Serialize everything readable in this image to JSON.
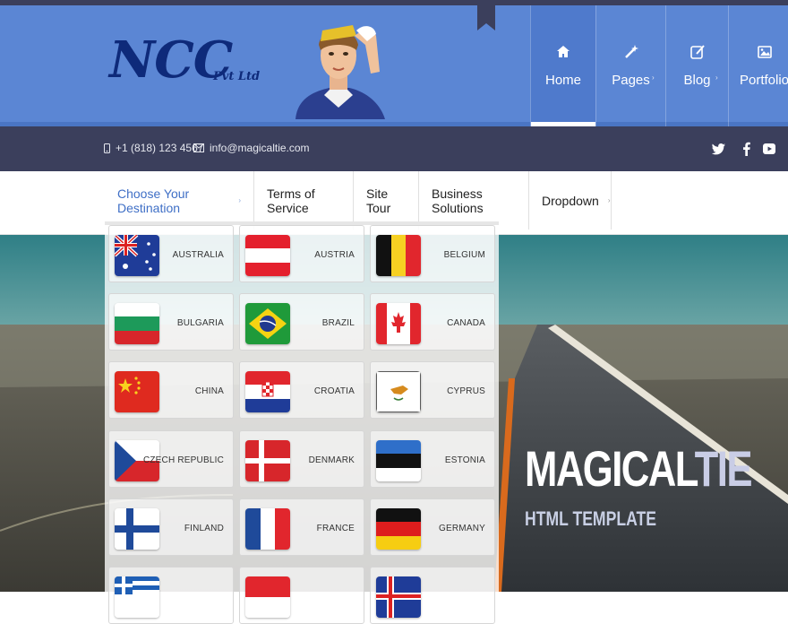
{
  "header": {
    "logo_main": "NCC",
    "logo_sub": "Pvt Ltd",
    "brand_color": "#5b86d4",
    "nav": [
      {
        "label": "Home",
        "icon": "home-icon",
        "active": true
      },
      {
        "label": "Pages",
        "icon": "magic-wand-icon",
        "active": false
      },
      {
        "label": "Blog",
        "icon": "edit-icon",
        "active": false
      },
      {
        "label": "Portfolio",
        "icon": "picture-icon",
        "active": false
      }
    ]
  },
  "infobar": {
    "phone": "+1 (818) 123 4567",
    "email": "info@magicaltie.com",
    "social": [
      "twitter-icon",
      "facebook-icon",
      "youtube-icon"
    ]
  },
  "menu": {
    "items": [
      "Choose Your Destination",
      "Terms of Service",
      "Site Tour",
      "Business Solutions",
      "Dropdown"
    ]
  },
  "destinations": [
    {
      "name": "AUSTRALIA"
    },
    {
      "name": "AUSTRIA"
    },
    {
      "name": "BELGIUM"
    },
    {
      "name": "BULGARIA"
    },
    {
      "name": "BRAZIL"
    },
    {
      "name": "CANADA"
    },
    {
      "name": "CHINA"
    },
    {
      "name": "CROATIA"
    },
    {
      "name": "CYPRUS"
    },
    {
      "name": "CZECH REPUBLIC"
    },
    {
      "name": "DENMARK"
    },
    {
      "name": "ESTONIA"
    },
    {
      "name": "FINLAND"
    },
    {
      "name": "FRANCE"
    },
    {
      "name": "GERMANY"
    }
  ],
  "hero": {
    "title_a": "MAGICAL",
    "title_b": "TIE",
    "subtitle": "HTML TEMPLATE"
  }
}
